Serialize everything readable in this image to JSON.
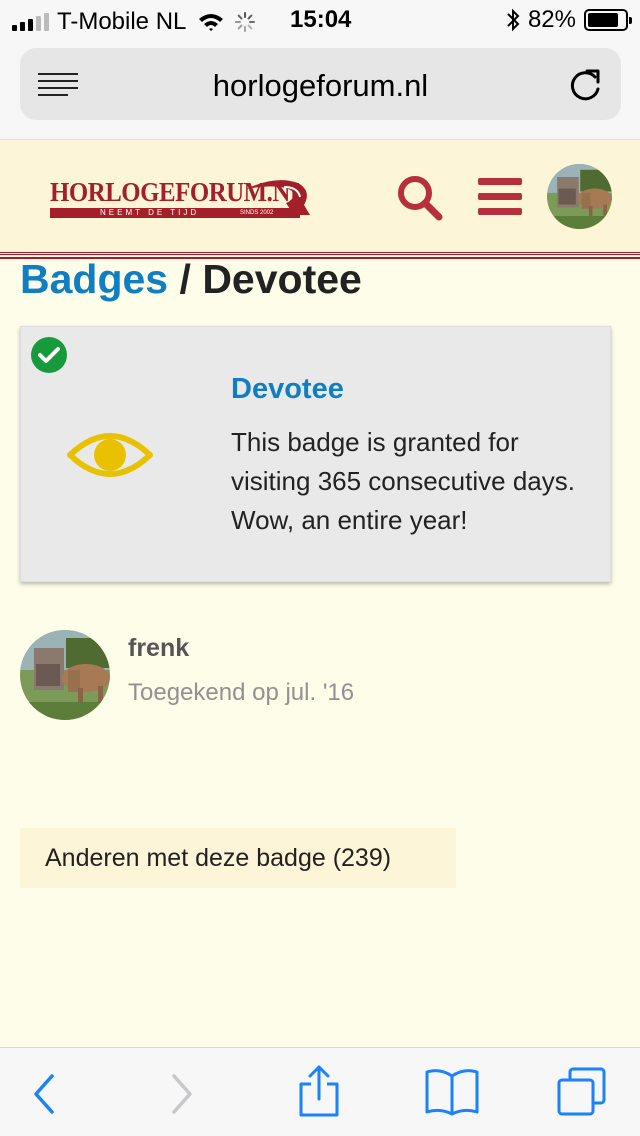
{
  "status_bar": {
    "carrier": "T-Mobile NL",
    "time": "15:04",
    "battery": "82%",
    "battery_level": 0.82,
    "icons": [
      "signal-icon",
      "wifi-icon",
      "activity-spinner-icon",
      "bluetooth-icon",
      "battery-icon"
    ]
  },
  "browser": {
    "url": "horlogeforum.nl",
    "icons": [
      "reader-view-icon",
      "reload-icon"
    ],
    "toolbar_icons": [
      "back-icon",
      "forward-icon",
      "share-icon",
      "bookmarks-icon",
      "tabs-icon"
    ]
  },
  "site_header": {
    "logo_title": "HORLOGEFORUM.NL",
    "logo_tagline": "NEEMT DE TIJD",
    "logo_since": "SINDS 2002",
    "icons": [
      "search-icon",
      "menu-icon"
    ]
  },
  "breadcrumb": {
    "parent": "Badges",
    "separator": "/",
    "current": "Devotee"
  },
  "badge": {
    "name": "Devotee",
    "description": "This badge is granted for visiting 365 consecutive days. Wow, an entire year!",
    "icon": "eye-icon",
    "granted_icon": "check-circle-icon"
  },
  "grant": {
    "username": "frenk",
    "granted_on": "Toegekend op jul. '16"
  },
  "others_button": {
    "label": "Anderen met deze badge (239)"
  },
  "colors": {
    "brand_red": "#a3202a",
    "link_blue": "#0f7ec3",
    "header_bg": "#fdf5d8",
    "page_bg": "#fefde9",
    "badge_gold": "#e8c200",
    "check_green": "#179b3a",
    "ios_blue": "#1a82fb"
  }
}
